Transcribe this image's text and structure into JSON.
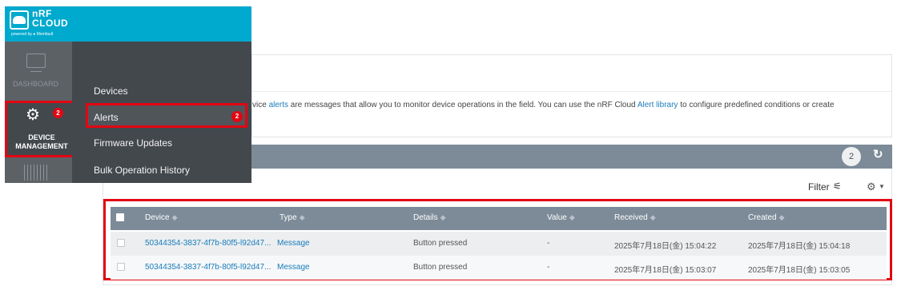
{
  "brand": {
    "name_line1": "nRF",
    "name_line2": "CLOUD",
    "powered_by": "powered by  ● Memfault"
  },
  "sidebar": {
    "dashboard_label": "DASHBOARD",
    "device_management_label_line1": "DEVICE",
    "device_management_label_line2": "MANAGEMENT",
    "device_management_badge": "2"
  },
  "submenu": {
    "items": [
      {
        "label": "Devices"
      },
      {
        "label": "Alerts",
        "badge": "2"
      },
      {
        "label": "Firmware Updates"
      },
      {
        "label": "Bulk Operation History"
      }
    ]
  },
  "info": {
    "text_prefix": "vice ",
    "alerts_link": "alerts",
    "text_middle": " are messages that allow you to monitor device operations in the field. You can use the nRF Cloud ",
    "alert_library_link": "Alert library",
    "text_suffix": " to configure predefined conditions or create"
  },
  "toolbar": {
    "count": "2",
    "filter_label": "Filter"
  },
  "table": {
    "columns": [
      "Device",
      "Type",
      "Details",
      "Value",
      "Received",
      "Created"
    ],
    "rows": [
      {
        "device": "50344354-3837-4f7b-80f5-l92d47...",
        "type": "Message",
        "details": "Button pressed",
        "value": "-",
        "received": "2025年7月18日(金) 15:04:22",
        "created": "2025年7月18日(金) 15:04:18"
      },
      {
        "device": "50344354-3837-4f7b-80f5-l92d47...",
        "type": "Message",
        "details": "Button pressed",
        "value": "-",
        "received": "2025年7月18日(金) 15:03:07",
        "created": "2025年7月18日(金) 15:03:05"
      }
    ]
  },
  "colors": {
    "brand": "#00a9ce",
    "highlight": "#e30613",
    "link": "#1a7dbb",
    "table_header": "#7d8b98"
  }
}
